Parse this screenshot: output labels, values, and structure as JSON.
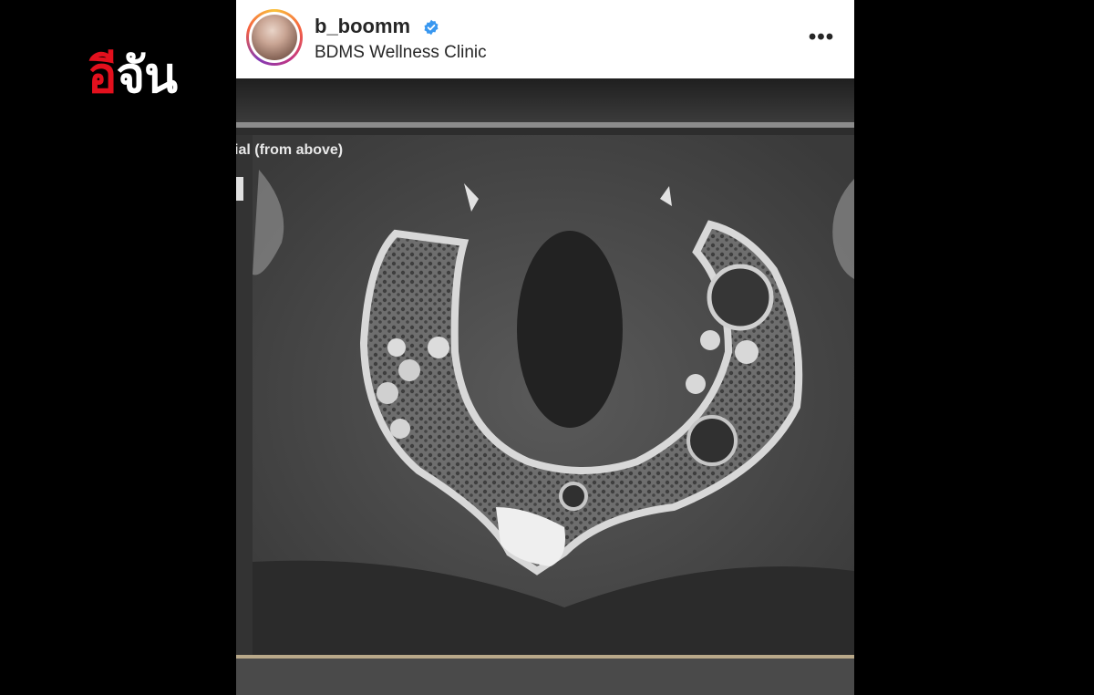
{
  "brand": {
    "prefix": "อี",
    "suffix": "จัน",
    "prefix_color": "#e3101d",
    "suffix_color": "#ffffff"
  },
  "post": {
    "username": "b_boomm",
    "verified": true,
    "location": "BDMS Wellness Clinic",
    "more_icon": "more-horizontal-icon",
    "more_label": "•••"
  },
  "image": {
    "ct_label": "ial (from above)"
  }
}
